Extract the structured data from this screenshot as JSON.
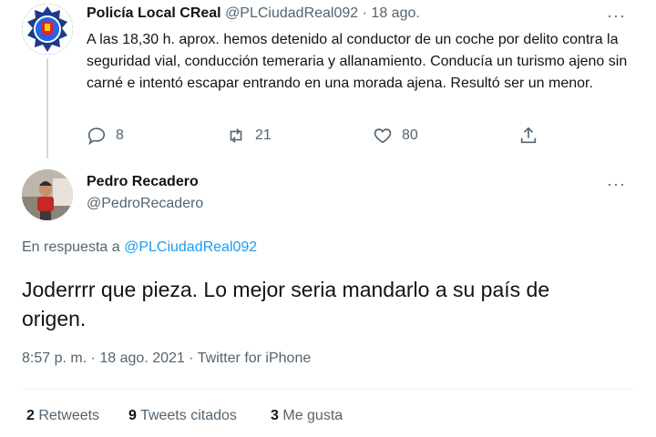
{
  "quoted_tweet": {
    "name": "Policía Local CReal",
    "handle": "@PLCiudadReal092",
    "separator": "·",
    "date": "18 ago.",
    "text": "A las 18,30 h. aprox. hemos detenido al conductor de un coche por delito contra la seguridad vial, conducción temeraria y allanamiento. Conducía un turismo ajeno sin carné e intentó escapar entrando en una morada ajena. Resultó ser un menor.",
    "replies": "8",
    "retweets": "21",
    "likes": "80",
    "avatar_icon": "police-badge-icon"
  },
  "reply_tweet": {
    "name": "Pedro Recadero",
    "handle": "@PedroRecadero",
    "reply_prefix": "En respuesta a",
    "reply_to": "@PLCiudadReal092",
    "text": "Joderrrr que pieza. Lo mejor seria mandarlo a su país de origen.",
    "time": "8:57 p. m.",
    "date": "18 ago. 2021",
    "source": "Twitter for iPhone",
    "separator": "·"
  },
  "stats": {
    "retweets_count": "2",
    "retweets_label": "Retweets",
    "quotes_count": "9",
    "quotes_label": "Tweets citados",
    "likes_count": "3",
    "likes_label": "Me gusta"
  },
  "more_glyph": "···",
  "colors": {
    "link": "#1d9bf0",
    "muted": "#536471",
    "line": "#cfd9de"
  }
}
